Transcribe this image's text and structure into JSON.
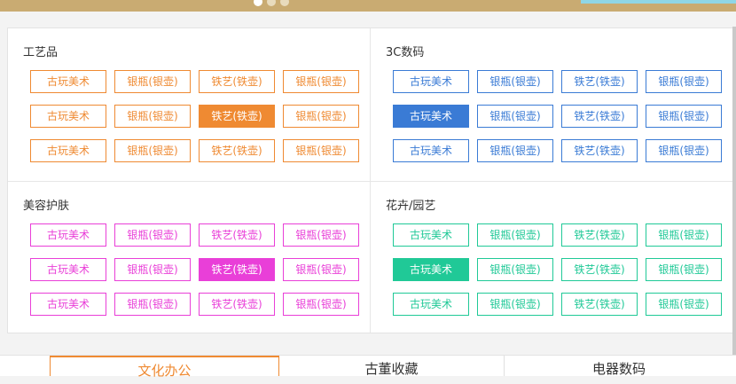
{
  "carousel": {
    "dot_count": 3,
    "active_index": 0
  },
  "colors": {
    "orange": "#ef8a32",
    "blue": "#3a7bd5",
    "pink": "#e93fd8",
    "green": "#20c997"
  },
  "sections": [
    {
      "title": "工艺品",
      "color": "#ef8a32",
      "rows": [
        [
          "古玩美术",
          "银瓶(银壶)",
          "铁艺(铁壶)",
          "银瓶(银壶)"
        ],
        [
          "古玩美术",
          "银瓶(银壶)",
          "铁艺(铁壶)",
          "银瓶(银壶)"
        ],
        [
          "古玩美术",
          "银瓶(银壶)",
          "铁艺(铁壶)",
          "银瓶(银壶)"
        ]
      ],
      "selected": [
        1,
        2
      ]
    },
    {
      "title": "3C数码",
      "color": "#3a7bd5",
      "rows": [
        [
          "古玩美术",
          "银瓶(银壶)",
          "铁艺(铁壶)",
          "银瓶(银壶)"
        ],
        [
          "古玩美术",
          "银瓶(银壶)",
          "铁艺(铁壶)",
          "银瓶(银壶)"
        ],
        [
          "古玩美术",
          "银瓶(银壶)",
          "铁艺(铁壶)",
          "银瓶(银壶)"
        ]
      ],
      "selected": [
        1,
        0
      ]
    },
    {
      "title": "美容护肤",
      "color": "#e93fd8",
      "rows": [
        [
          "古玩美术",
          "银瓶(银壶)",
          "铁艺(铁壶)",
          "银瓶(银壶)"
        ],
        [
          "古玩美术",
          "银瓶(银壶)",
          "铁艺(铁壶)",
          "银瓶(银壶)"
        ],
        [
          "古玩美术",
          "银瓶(银壶)",
          "铁艺(铁壶)",
          "银瓶(银壶)"
        ]
      ],
      "selected": [
        1,
        2
      ]
    },
    {
      "title": "花卉/园艺",
      "color": "#20c997",
      "rows": [
        [
          "古玩美术",
          "银瓶(银壶)",
          "铁艺(铁壶)",
          "银瓶(银壶)"
        ],
        [
          "古玩美术",
          "银瓶(银壶)",
          "铁艺(铁壶)",
          "银瓶(银壶)"
        ],
        [
          "古玩美术",
          "银瓶(银壶)",
          "铁艺(铁壶)",
          "银瓶(银壶)"
        ]
      ],
      "selected": [
        1,
        0
      ]
    }
  ],
  "bottom_tabs": [
    {
      "label": "文化办公",
      "active": true
    },
    {
      "label": "古董收藏",
      "active": false
    },
    {
      "label": "电器数码",
      "active": false
    }
  ]
}
